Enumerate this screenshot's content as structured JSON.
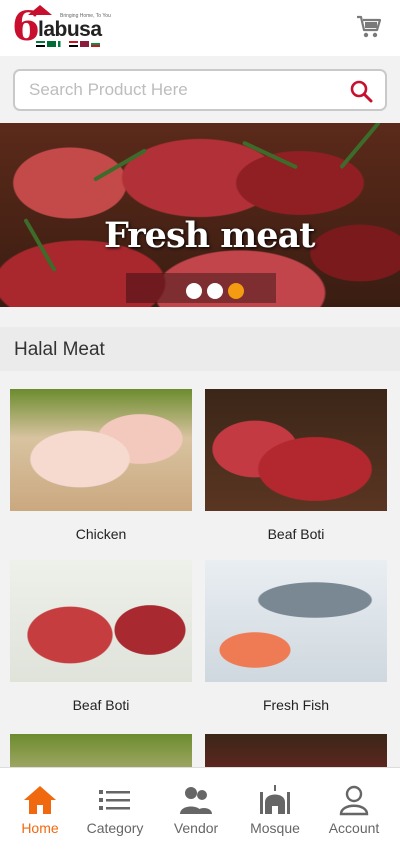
{
  "header": {
    "logo": {
      "brand_digit": "6",
      "brand_word": "labusa",
      "tagline": "Bringing Home, To You"
    },
    "cart_icon": "cart-icon"
  },
  "search": {
    "placeholder": "Search Product Here",
    "value": "",
    "icon": "search-icon"
  },
  "banner": {
    "caption": "Fresh meat",
    "slides": 3,
    "active_slide_index": 2,
    "accent_color": "#f39c12"
  },
  "section": {
    "title": "Halal Meat"
  },
  "products": [
    {
      "name": "Chicken",
      "image": "chicken-image"
    },
    {
      "name": "Beaf Boti",
      "image": "beef-image"
    },
    {
      "name": "Beaf Boti",
      "image": "beef-image"
    },
    {
      "name": "Fresh Fish",
      "image": "fish-image"
    }
  ],
  "bottom_nav": {
    "active_color": "#f0690f",
    "items": [
      {
        "label": "Home",
        "icon": "home-icon",
        "active": true
      },
      {
        "label": "Category",
        "icon": "list-icon",
        "active": false
      },
      {
        "label": "Vendor",
        "icon": "users-icon",
        "active": false
      },
      {
        "label": "Mosque",
        "icon": "mosque-icon",
        "active": false
      },
      {
        "label": "Account",
        "icon": "user-icon",
        "active": false
      }
    ]
  }
}
